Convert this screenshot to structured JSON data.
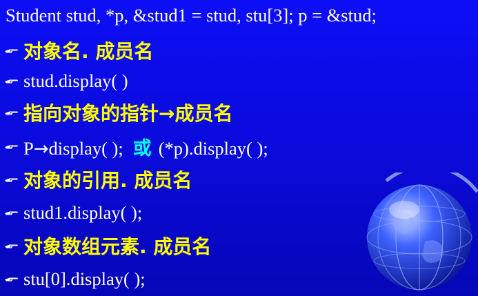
{
  "header": "Student stud, *p, &stud1 = stud, stu[3];  p = &stud;",
  "bullet_icon": "pointing-hand-icon",
  "lines": [
    {
      "text": "对象名. 成员名"
    },
    {
      "text": "stud.display( )"
    },
    {
      "before": "指向对象的指针",
      "arrow": "→",
      "after": "成员名"
    },
    {
      "before": "P",
      "arrow": "→",
      "after": "display( );",
      "or": "或",
      "tail": "(*p).display( );"
    },
    {
      "text": "对象的引用. 成员名"
    },
    {
      "text": "stud1.display( );"
    },
    {
      "text": "对象数组元素. 成员名"
    },
    {
      "text": "stu[0].display( );"
    }
  ],
  "colors": {
    "background": "#0a0ad8",
    "heading_text": "#ffff00",
    "code_text": "#ffffff",
    "or_text": "#00ffff"
  },
  "decoration": "globe-icon"
}
